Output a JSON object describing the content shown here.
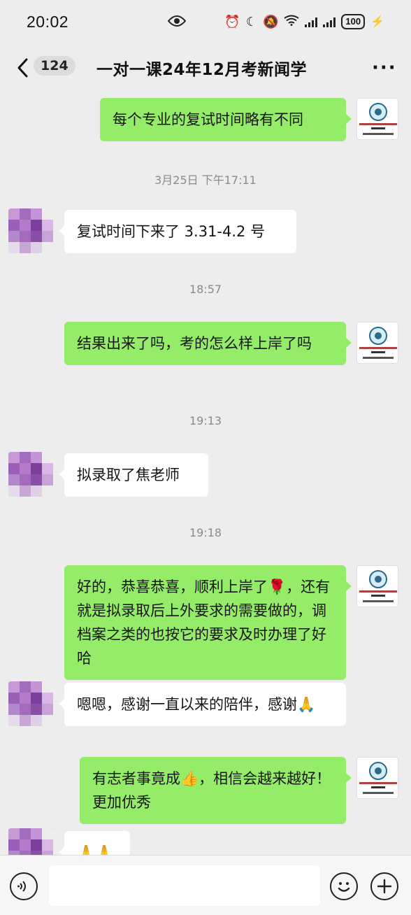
{
  "status_bar": {
    "time": "20:02",
    "battery": "100"
  },
  "nav": {
    "unread_count": "124",
    "title": "一对一课24年12月考新闻学",
    "more": "···"
  },
  "messages": [
    {
      "type": "out",
      "text": "每个专业的复试时间略有不同"
    },
    {
      "type": "time",
      "text": "3月25日 下午17:11"
    },
    {
      "type": "in",
      "text": "复试时间下来了 3.31-4.2 号"
    },
    {
      "type": "time",
      "text": "18:57"
    },
    {
      "type": "out",
      "text": "结果出来了吗，考的怎么样上岸了吗"
    },
    {
      "type": "time",
      "text": "19:13"
    },
    {
      "type": "in",
      "text": "拟录取了焦老师"
    },
    {
      "type": "time",
      "text": "19:18"
    },
    {
      "type": "out",
      "text": "好的，恭喜恭喜，顺利上岸了🌹，还有就是拟录取后上外要求的需要做的，调档案之类的也按它的要求及时办理了好哈"
    },
    {
      "type": "in",
      "text": "嗯嗯，感谢一直以来的陪伴，感谢🙏"
    },
    {
      "type": "out",
      "text": "有志者事竟成👍，相信会越来越好！更加优秀"
    },
    {
      "type": "in",
      "text": "🙏🙏"
    }
  ],
  "avatar_me": {
    "line1": "上外及上海高分院校考研",
    "line2": "焦老师",
    "line3": "13641868909"
  },
  "colors": {
    "outgoing_bubble": "#95ec69",
    "incoming_bubble": "#ffffff",
    "background": "#ededed"
  },
  "input_bar": {
    "icons": [
      "voice-icon",
      "emoji-icon",
      "plus-icon"
    ]
  }
}
